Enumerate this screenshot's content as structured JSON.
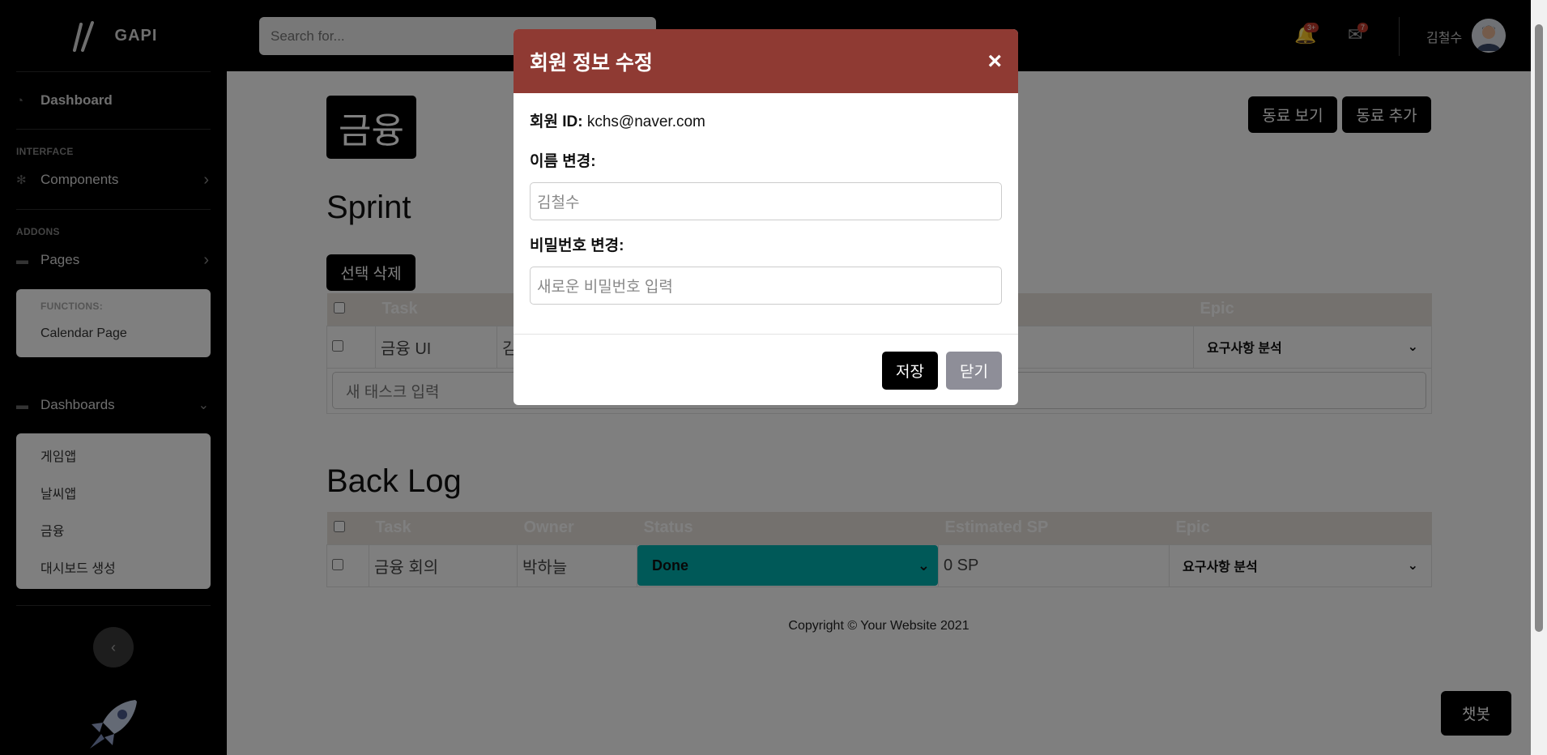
{
  "sidebar": {
    "brand": "GAPI",
    "dashboard": "Dashboard",
    "interface_heading": "INTERFACE",
    "components": "Components",
    "addons_heading": "ADDONS",
    "pages": "Pages",
    "functions_heading": "FUNCTIONS:",
    "calendar_page": "Calendar Page",
    "dashboards": "Dashboards",
    "dashboards_items": [
      "게임앱",
      "날씨앱",
      "금융",
      "대시보드 생성"
    ]
  },
  "topbar": {
    "search_placeholder": "Search for...",
    "alerts_badge": "3+",
    "messages_badge": "7",
    "user_name": "김철수"
  },
  "main": {
    "page_title": "금융",
    "view_colleagues": "동료 보기",
    "add_colleague": "동료 추가",
    "sprint_title": "Sprint",
    "delete_selected": "선택 삭제",
    "sprint_table": {
      "headers": [
        "Task",
        "",
        "",
        "SP",
        "Epic"
      ],
      "rows": [
        {
          "task": "금융 UI",
          "owner_partial": "김",
          "epic": "요구사항 분석"
        }
      ],
      "new_task_placeholder": "새 태스크 입력"
    },
    "backlog_title": "Back Log",
    "backlog_table": {
      "headers": [
        "Task",
        "Owner",
        "Status",
        "Estimated SP",
        "Epic"
      ],
      "rows": [
        {
          "task": "금융 회의",
          "owner": "박하늘",
          "status": "Done",
          "sp": "0 SP",
          "epic": "요구사항 분석"
        }
      ]
    },
    "copyright": "Copyright © Your Website 2021",
    "chatbot": "챗봇"
  },
  "modal": {
    "title": "회원 정보 수정",
    "close": "×",
    "member_id_label": "회원 ID:",
    "member_id_value": "kchs@naver.com",
    "name_label": "이름 변경:",
    "name_value": "김철수",
    "password_label": "비밀번호 변경:",
    "password_placeholder": "새로운 비밀번호 입력",
    "save": "저장",
    "cancel": "닫기"
  },
  "colors": {
    "modal_header": "#8f3a33",
    "status_done": "#00b3b0",
    "close_button": "#8e8e98"
  }
}
